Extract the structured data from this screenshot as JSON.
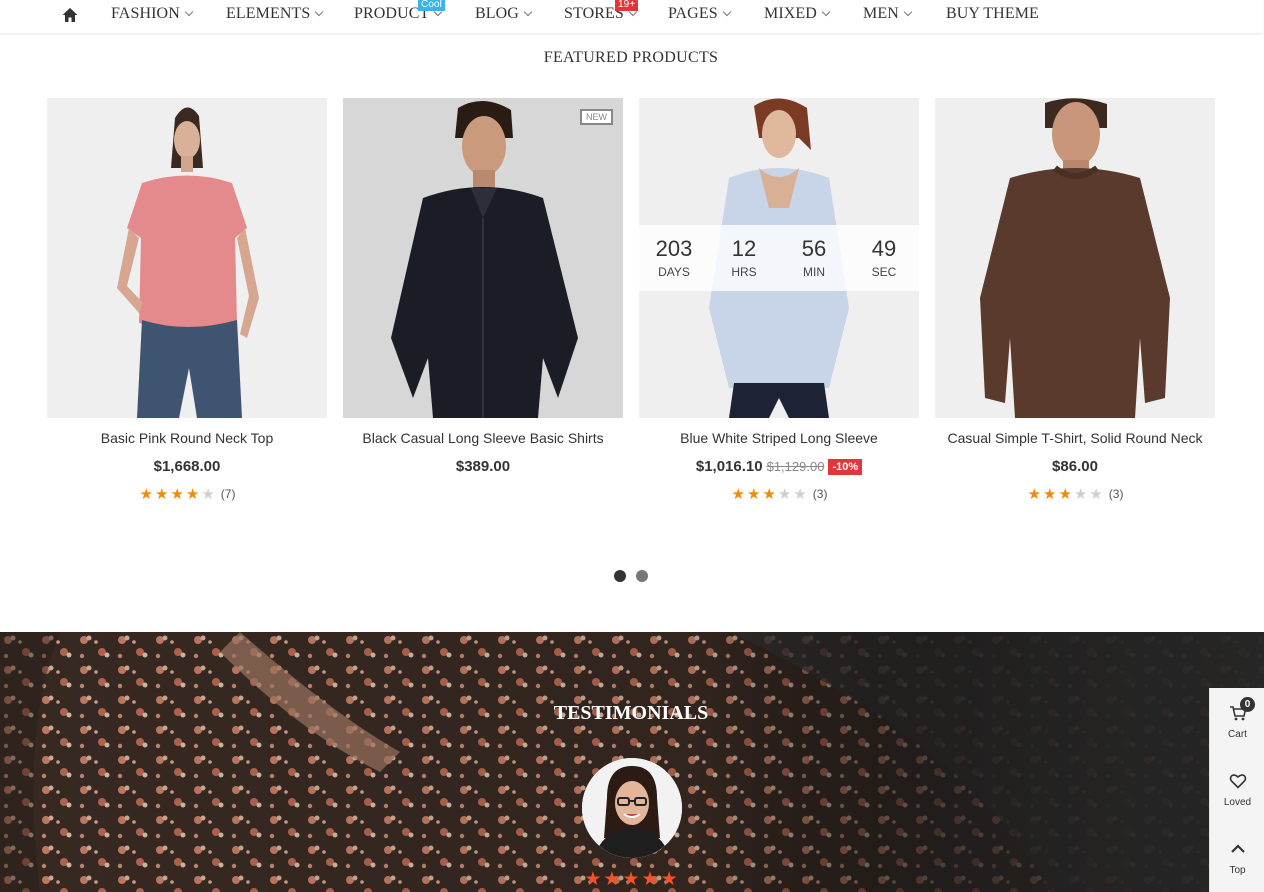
{
  "nav": {
    "items": [
      {
        "label": "FASHION"
      },
      {
        "label": "ELEMENTS"
      },
      {
        "label": "PRODUCT",
        "badge": "Cool",
        "badge_color": "#3ab4e6"
      },
      {
        "label": "BLOG"
      },
      {
        "label": "STORES",
        "badge": "19+",
        "badge_color": "#e2363a"
      },
      {
        "label": "PAGES"
      },
      {
        "label": "MIXED"
      },
      {
        "label": "MEN"
      },
      {
        "label": "BUY THEME"
      }
    ]
  },
  "featured": {
    "title": "FEATURED PRODUCTS",
    "products": [
      {
        "name": "Basic Pink Round Neck Top",
        "price": "$1,668.00",
        "rating": 4,
        "reviews": "(7)"
      },
      {
        "name": "Black Casual Long Sleeve Basic Shirts",
        "price": "$389.00",
        "badge": "NEW"
      },
      {
        "name": "Blue White Striped Long Sleeve",
        "price": "$1,016.10",
        "old_price": "$1,129.00",
        "discount": "-10%",
        "rating": 3,
        "reviews": "(3)",
        "countdown": [
          {
            "value": "203",
            "label": "DAYS"
          },
          {
            "value": "12",
            "label": "HRS"
          },
          {
            "value": "56",
            "label": "MIN"
          },
          {
            "value": "49",
            "label": "SEC"
          }
        ]
      },
      {
        "name": "Casual Simple T-Shirt, Solid Round Neck",
        "price": "$86.00",
        "rating": 3,
        "reviews": "(3)"
      }
    ],
    "pagination": {
      "pages": 2,
      "active": 1
    }
  },
  "testimonials": {
    "title": "TESTIMONIALS",
    "rating": 5
  },
  "widget": {
    "cart_label": "Cart",
    "cart_count": "0",
    "loved_label": "Loved",
    "top_label": "Top"
  },
  "colors": {
    "star": "#f08a0b",
    "discount": "#e2363a",
    "testimonial_star": "#f0542a"
  }
}
